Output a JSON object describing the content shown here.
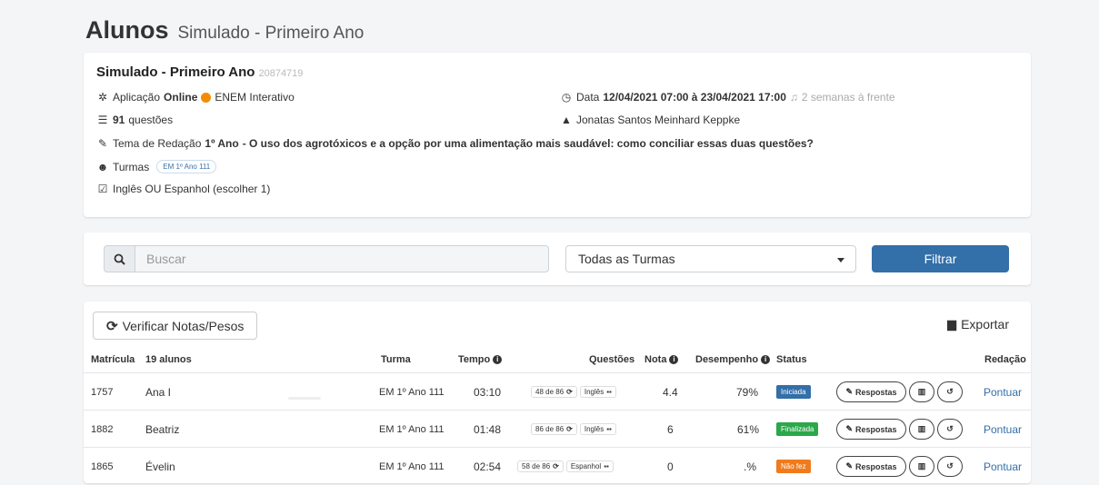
{
  "header": {
    "title": "Alunos",
    "subtitle": "Simulado - Primeiro Ano"
  },
  "info": {
    "title": "Simulado - Primeiro Ano",
    "code": "20874719",
    "aplicacao_prefix": "Aplicação",
    "aplicacao_mode": "Online",
    "aplicacao_type": "ENEM Interativo",
    "data_prefix": "Data",
    "data_range": "12/04/2021 07:00 à 23/04/2021 17:00",
    "data_relative": "2 semanas à frente",
    "questoes_count": "91",
    "questoes_label": "questões",
    "teacher": "Jonatas Santos Meinhard Keppke",
    "redacao_prefix": "Tema de Redação",
    "redacao_year": "1º Ano",
    "redacao_theme": "- O uso dos agrotóxicos e a opção por uma alimentação mais saudável: como conciliar essas duas questões?",
    "turmas_label": "Turmas",
    "turma_chip": "EM 1º Ano 111",
    "lingua": "Inglês OU Espanhol (escolher 1)"
  },
  "filters": {
    "search_placeholder": "Buscar",
    "turma_select": "Todas as Turmas",
    "filter_button": "Filtrar"
  },
  "toolbar": {
    "verify_label": "Verificar Notas/Pesos",
    "export_label": "Exportar"
  },
  "table": {
    "headers": {
      "matricula": "Matrícula",
      "alunos": "19 alunos",
      "turma": "Turma",
      "tempo": "Tempo",
      "questoes": "Questões",
      "nota": "Nota",
      "desempenho": "Desempenho",
      "status": "Status",
      "redacao": "Redação"
    },
    "rows": [
      {
        "matricula": "1757",
        "nome": "Ana I",
        "turma": "EM 1º Ano 111",
        "tempo": "03:10",
        "questoes": "48 de 86",
        "lingua": "Inglês",
        "nota": "4.4",
        "desempenho": "79%",
        "status": "Iniciada",
        "respostas": "Respostas",
        "redacao": "Pontuar"
      },
      {
        "matricula": "1882",
        "nome": "Beatriz",
        "turma": "EM 1º Ano 111",
        "tempo": "01:48",
        "questoes": "86 de 86",
        "lingua": "Inglês",
        "nota": "6",
        "desempenho": "61%",
        "status": "Finalizada",
        "respostas": "Respostas",
        "redacao": "Pontuar"
      },
      {
        "matricula": "1865",
        "nome": "Évelin",
        "turma": "EM 1º Ano 111",
        "tempo": "02:54",
        "questoes": "58 de 86",
        "lingua": "Espanhol",
        "nota": "0",
        "desempenho": ".%",
        "status": "Não fez",
        "respostas": "Respostas",
        "redacao": "Pontuar"
      }
    ]
  }
}
